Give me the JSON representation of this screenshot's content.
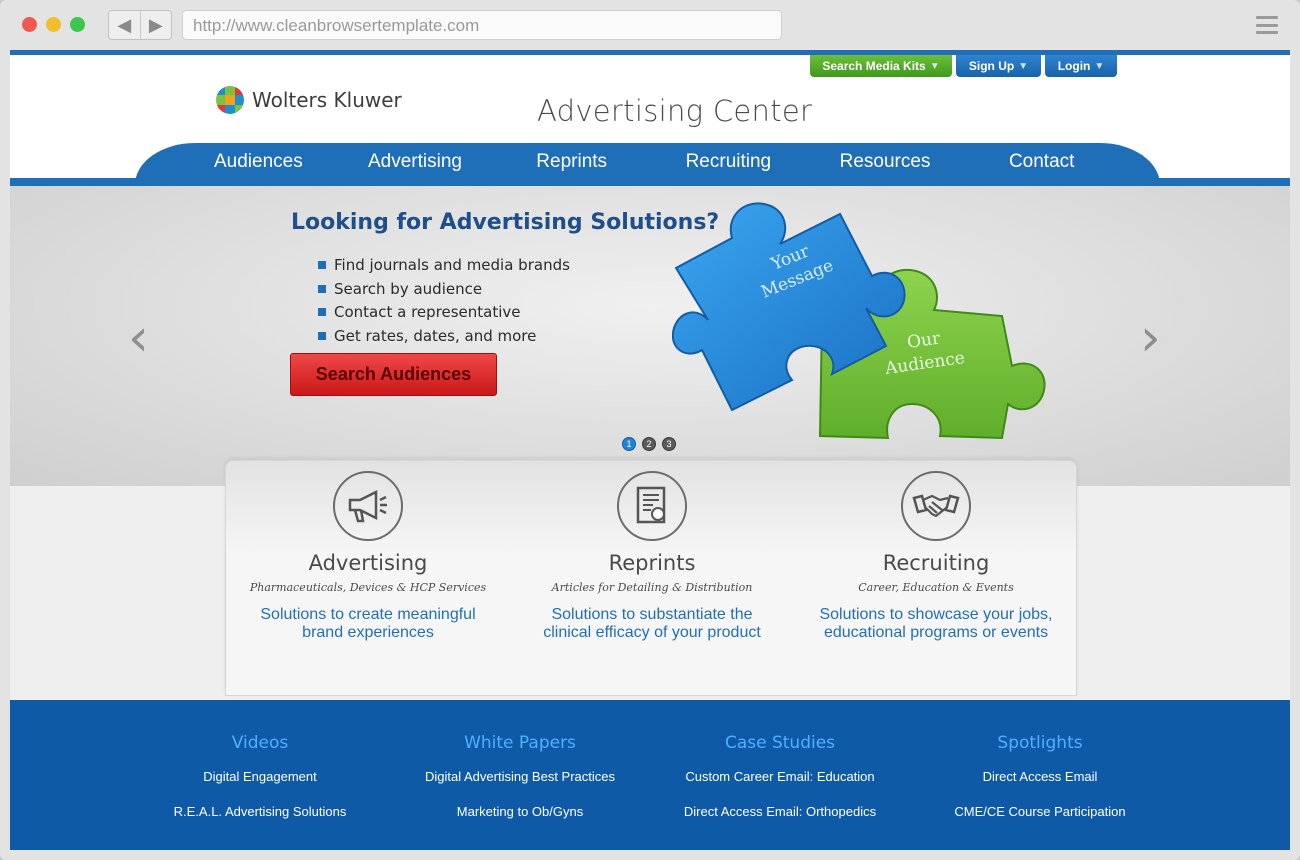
{
  "browser": {
    "url": "http://www.cleanbrowsertemplate.com",
    "back_glyph": "◀",
    "forward_glyph": "▶"
  },
  "utility_nav": {
    "media_kits": "Search Media Kits",
    "sign_up": "Sign Up",
    "login": "Login",
    "caret": "▼"
  },
  "brand": {
    "name": "Wolters Kluwer",
    "site_title": "Advertising Center"
  },
  "main_nav": [
    "Audiences",
    "Advertising",
    "Reprints",
    "Recruiting",
    "Resources",
    "Contact"
  ],
  "hero": {
    "title": "Looking for Advertising Solutions?",
    "bullets": [
      "Find journals and media brands",
      "Search by audience",
      "Contact a representative",
      "Get rates, dates, and more"
    ],
    "cta": "Search Audiences",
    "puzzle_piece_1": [
      "Your",
      "Message"
    ],
    "puzzle_piece_2": [
      "Our",
      "Audience"
    ],
    "prev_arrow": "‹",
    "next_arrow": "›",
    "slides": [
      "1",
      "2",
      "3"
    ],
    "active_slide": 1
  },
  "features": [
    {
      "title": "Advertising",
      "subtitle": "Pharmaceuticals, Devices & HCP Services",
      "desc_line1": "Solutions to create meaningful",
      "desc_line2": "brand experiences",
      "icon": "megaphone-icon"
    },
    {
      "title": "Reprints",
      "subtitle": "Articles for Detailing & Distribution",
      "desc_line1": "Solutions to substantiate the",
      "desc_line2": "clinical efficacy of your product",
      "icon": "document-icon"
    },
    {
      "title": "Recruiting",
      "subtitle": "Career, Education & Events",
      "desc_line1": "Solutions to showcase your jobs,",
      "desc_line2": "educational programs or events",
      "icon": "handshake-icon"
    }
  ],
  "footer": [
    {
      "heading": "Videos",
      "links": [
        "Digital Engagement",
        "R.E.A.L. Advertising Solutions"
      ]
    },
    {
      "heading": "White Papers",
      "links": [
        "Digital Advertising Best Practices",
        "Marketing to Ob/Gyns"
      ]
    },
    {
      "heading": "Case Studies",
      "links": [
        "Custom Career Email: Education",
        "Direct Access Email: Orthopedics"
      ]
    },
    {
      "heading": "Spotlights",
      "links": [
        "Direct Access Email",
        "CME/CE Course Participation"
      ]
    }
  ],
  "colors": {
    "brand_blue": "#1f6fb8",
    "cta_red": "#e23030",
    "media_kit_green": "#5aae2e",
    "footer_blue": "#0f5aa7"
  }
}
